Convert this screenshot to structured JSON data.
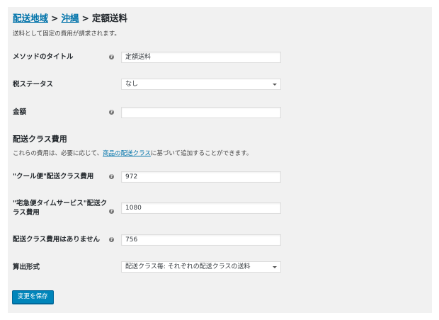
{
  "breadcrumb": {
    "shipping_zones": "配送地域",
    "sep1": ">",
    "okinawa": "沖縄",
    "sep2": ">",
    "current": "定額送料"
  },
  "description": "送料として固定の費用が請求されます。",
  "fields": {
    "method_title": {
      "label": "メソッドのタイトル",
      "value": "定額送料"
    },
    "tax_status": {
      "label": "税ステータス",
      "value": "なし"
    },
    "cost": {
      "label": "金額",
      "value": ""
    }
  },
  "shipping_class_costs": {
    "title": "配送クラス費用",
    "desc_before": "これらの費用は、必要に応じて、",
    "desc_link": "商品の配送クラス",
    "desc_after": "に基づいて追加することができます。",
    "cool": {
      "label": "\"クール便\"配送クラス費用",
      "value": "972"
    },
    "takkyubin_line1": "\"宅急便タイムサービス\"配送ク",
    "takkyubin_line2": "ラス費用",
    "takkyubin_value": "1080",
    "no_class": {
      "label": "配送クラス費用はありません",
      "value": "756"
    },
    "calc_type": {
      "label": "算出形式",
      "value": "配送クラス毎: それぞれの配送クラスの送料"
    }
  },
  "help_icon_glyph": "?",
  "save_button": "変更を保存",
  "colors": {
    "link": "#0073aa",
    "button": "#0085ba",
    "panel": "#f1f1f1"
  }
}
